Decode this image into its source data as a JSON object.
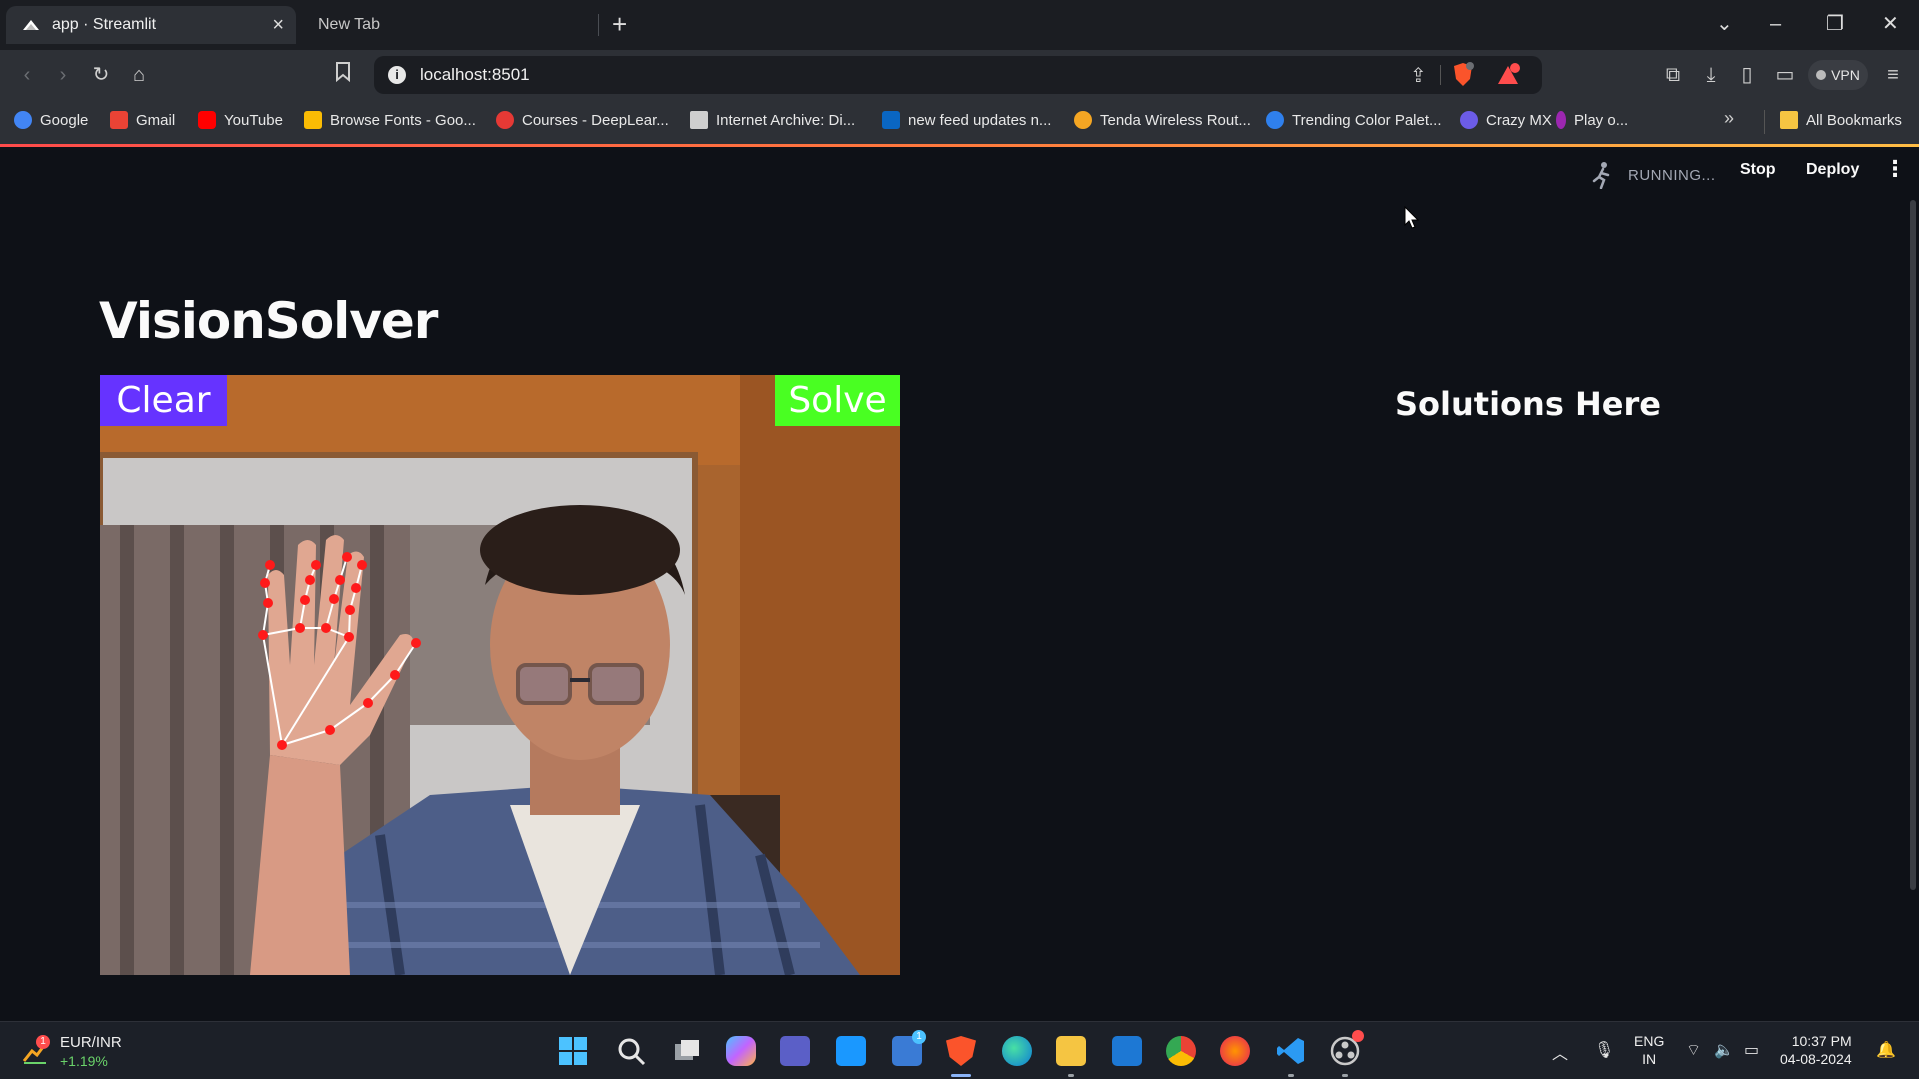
{
  "browser": {
    "tabs": [
      {
        "title": "app · Streamlit",
        "active": true
      },
      {
        "title": "New Tab",
        "active": false
      }
    ],
    "url": "localhost:8501",
    "vpn_label": "VPN",
    "bookmarks": [
      {
        "label": "Google",
        "icon": "google-icon",
        "color": "#4285f4"
      },
      {
        "label": "Gmail",
        "icon": "gmail-icon",
        "color": "#ea4335"
      },
      {
        "label": "YouTube",
        "icon": "youtube-icon",
        "color": "#ff0000"
      },
      {
        "label": "Browse Fonts - Goo...",
        "icon": "google-fonts-icon",
        "color": "#fbbc04"
      },
      {
        "label": "Courses - DeepLear...",
        "icon": "deeplearning-icon",
        "color": "#e53935"
      },
      {
        "label": "Internet Archive: Di...",
        "icon": "archive-icon",
        "color": "#cfcfcf"
      },
      {
        "label": "new feed updates n...",
        "icon": "linkedin-icon",
        "color": "#0a66c2"
      },
      {
        "label": "Tenda Wireless Rout...",
        "icon": "tenda-icon",
        "color": "#f5a623"
      },
      {
        "label": "Trending Color Palet...",
        "icon": "coolors-icon",
        "color": "#2f80ed"
      },
      {
        "label": "Crazy MX",
        "icon": "crazymx-icon",
        "color": "#6c5ce7"
      },
      {
        "label": "Play o...",
        "icon": "play-icon",
        "color": "#9c27b0"
      }
    ],
    "all_bookmarks_label": "All Bookmarks"
  },
  "streamlit": {
    "status": "RUNNING...",
    "stop_label": "Stop",
    "deploy_label": "Deploy",
    "app_title": "VisionSolver",
    "solutions_title": "Solutions Here",
    "camera": {
      "clear_label": "Clear",
      "solve_label": "Solve",
      "clear_color": "#6633ff",
      "solve_color": "#49ff22",
      "landmark_color": "#ff1a1a"
    }
  },
  "taskbar": {
    "ticker_name": "EUR/INR",
    "ticker_change": "+1.19%",
    "ticker_badge": "1",
    "language_line1": "ENG",
    "language_line2": "IN",
    "time": "10:37 PM",
    "date": "04-08-2024",
    "pinned": [
      "windows-start-icon",
      "search-icon",
      "task-view-icon",
      "copilot-icon",
      "teams-icon",
      "prime-video-icon",
      "store-icon",
      "brave-icon",
      "edge-icon",
      "file-explorer-icon",
      "mail-icon",
      "chrome-icon",
      "firefox-icon",
      "vscode-icon",
      "obs-icon"
    ]
  }
}
